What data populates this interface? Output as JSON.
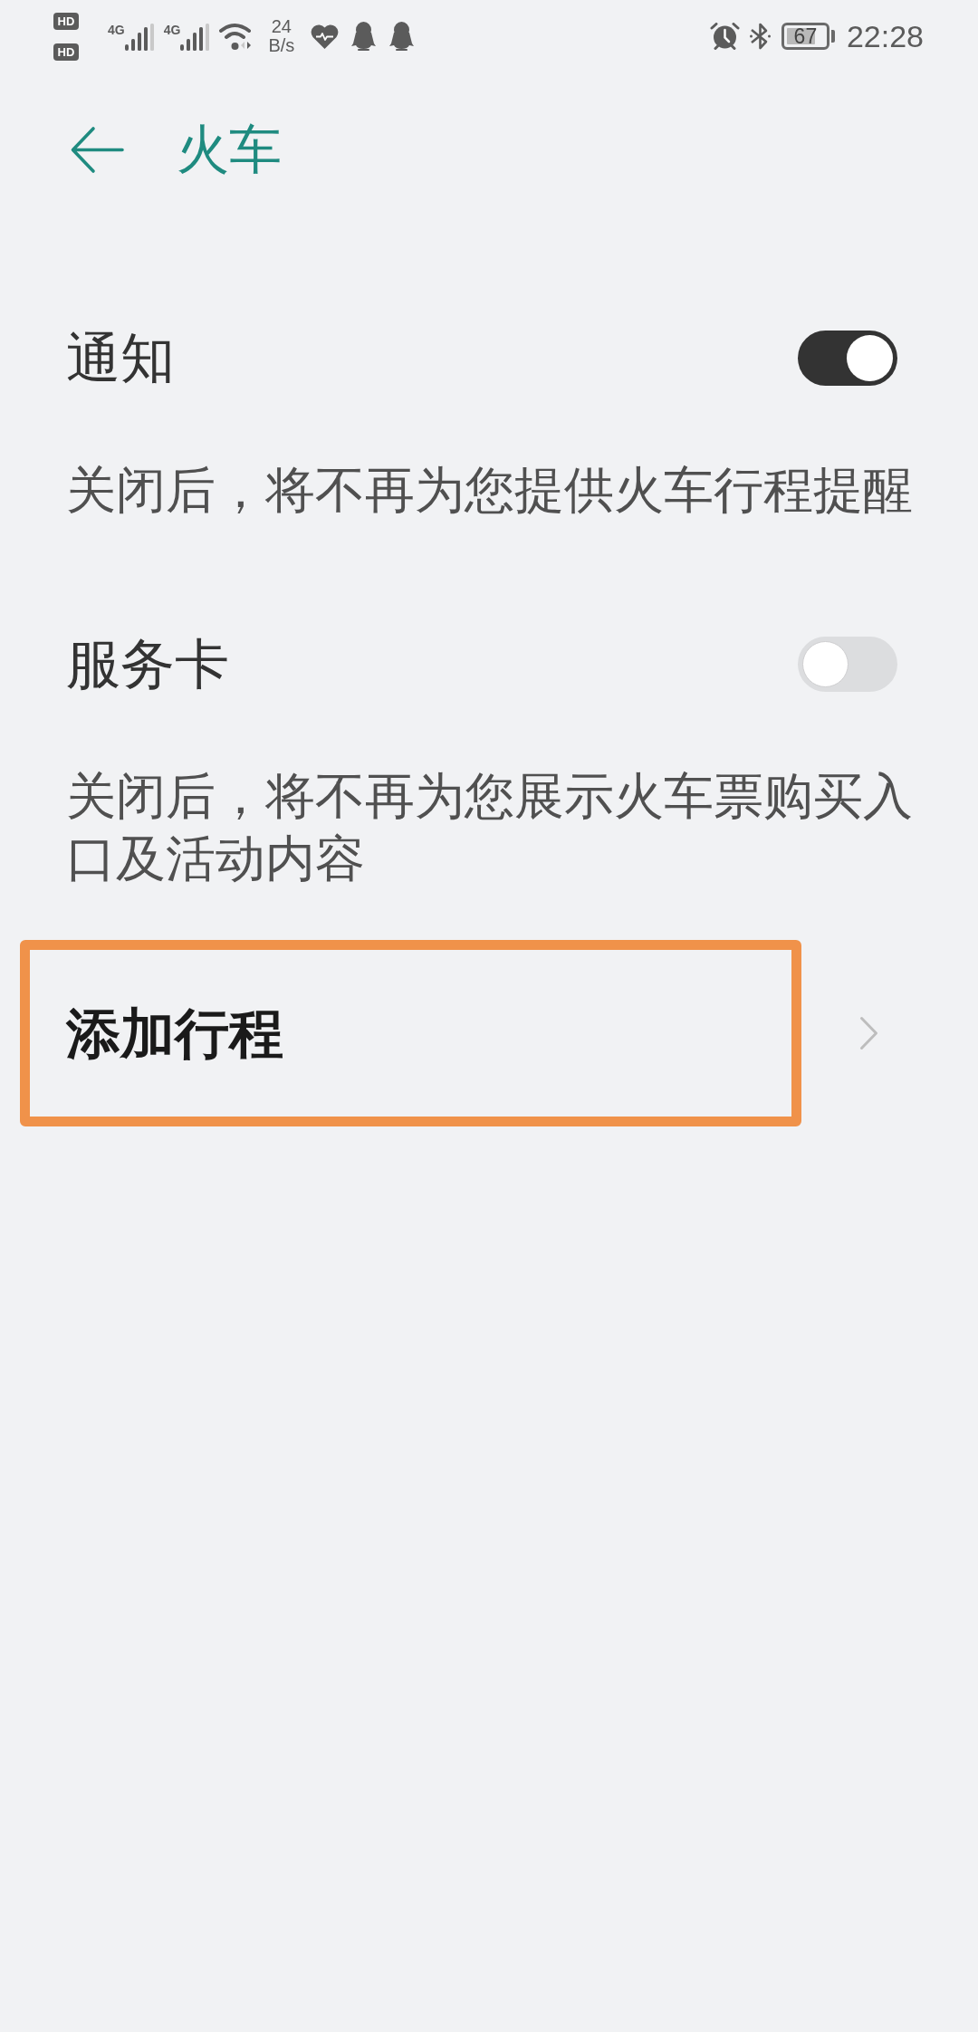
{
  "status_bar": {
    "hd_badges": [
      "HD",
      "HD"
    ],
    "networks": [
      "4G",
      "4G"
    ],
    "net_speed": {
      "value": "24",
      "unit": "B/s"
    },
    "battery": "67",
    "time": "22:28"
  },
  "header": {
    "title": "火车"
  },
  "settings": [
    {
      "kind": "toggle",
      "title": "通知",
      "on": true,
      "description": "关闭后，将不再为您提供火车行程提醒"
    },
    {
      "kind": "toggle",
      "title": "服务卡",
      "on": false,
      "description": "关闭后，将不再为您展示火车票购买入口及活动内容"
    },
    {
      "kind": "link",
      "title": "添加行程",
      "highlighted": true
    }
  ]
}
